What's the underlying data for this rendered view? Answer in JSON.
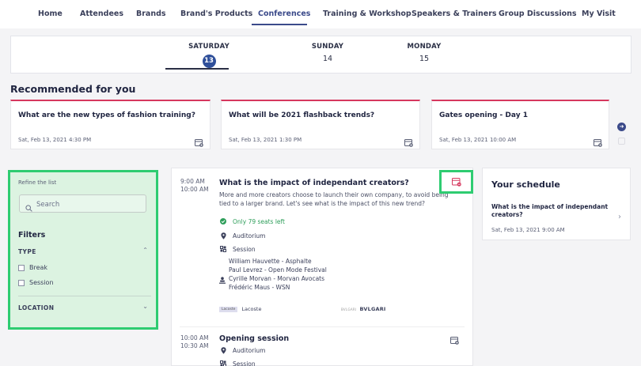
{
  "nav": {
    "items": [
      {
        "label": "Home"
      },
      {
        "label": "Attendees"
      },
      {
        "label": "Brands"
      },
      {
        "label": "Brand's Products"
      },
      {
        "label": "Conferences"
      },
      {
        "label": "Training & Workshop"
      },
      {
        "label": "Speakers & Trainers"
      },
      {
        "label": "Group Discussions"
      },
      {
        "label": "My Visit"
      }
    ],
    "active": "Conferences"
  },
  "days": [
    {
      "name": "SATURDAY",
      "number": "13",
      "selected": true
    },
    {
      "name": "SUNDAY",
      "number": "14",
      "selected": false
    },
    {
      "name": "MONDAY",
      "number": "15",
      "selected": false
    }
  ],
  "recommended": {
    "title": "Recommended for you",
    "cards": [
      {
        "title": "What are the new types of fashion training?",
        "date": "Sat, Feb 13, 2021 4:30 PM"
      },
      {
        "title": "What will be 2021 flashback trends?",
        "date": "Sat, Feb 13, 2021 1:30 PM"
      },
      {
        "title": "Gates opening - Day 1",
        "date": "Sat, Feb 13, 2021 10:00 AM"
      }
    ]
  },
  "filters": {
    "refine_label": "Refine the list",
    "search_placeholder": "Search",
    "heading": "Filters",
    "type_label": "TYPE",
    "type_options": [
      "Break",
      "Session"
    ],
    "location_label": "LOCATION"
  },
  "sessions": [
    {
      "start": "9:00 AM",
      "end": "10:00 AM",
      "title": "What is the impact of independant creators?",
      "description": "More and more creators choose to launch their own company, to avoid being tied to a larger brand. Let's see what is the impact of this new trend?",
      "seats": "Only 79 seats left",
      "location": "Auditorium",
      "type": "Session",
      "speakers": [
        "William Hauvette - Asphalte",
        "Paul Levrez - Open Mode Festival",
        "Cyrille Morvan - Morvan Avocats",
        "Frédéric Maus - WSN"
      ],
      "brands": [
        {
          "mark": "Lacoste",
          "name": "Lacoste"
        },
        {
          "pre": "BVLGARI",
          "name": "BVLGARI"
        }
      ]
    },
    {
      "start": "10:00 AM",
      "end": "10:30 AM",
      "title": "Opening session",
      "location": "Auditorium",
      "type": "Session"
    }
  ],
  "schedule": {
    "title": "Your schedule",
    "item_title": "What is the impact of independant creators?",
    "item_date": "Sat, Feb 13, 2021 9:00 AM"
  },
  "colors": {
    "accent": "#2f4f9a",
    "card_top": "#d6375e",
    "highlight": "#2ecc71",
    "seats_green": "#2e9e5a"
  }
}
